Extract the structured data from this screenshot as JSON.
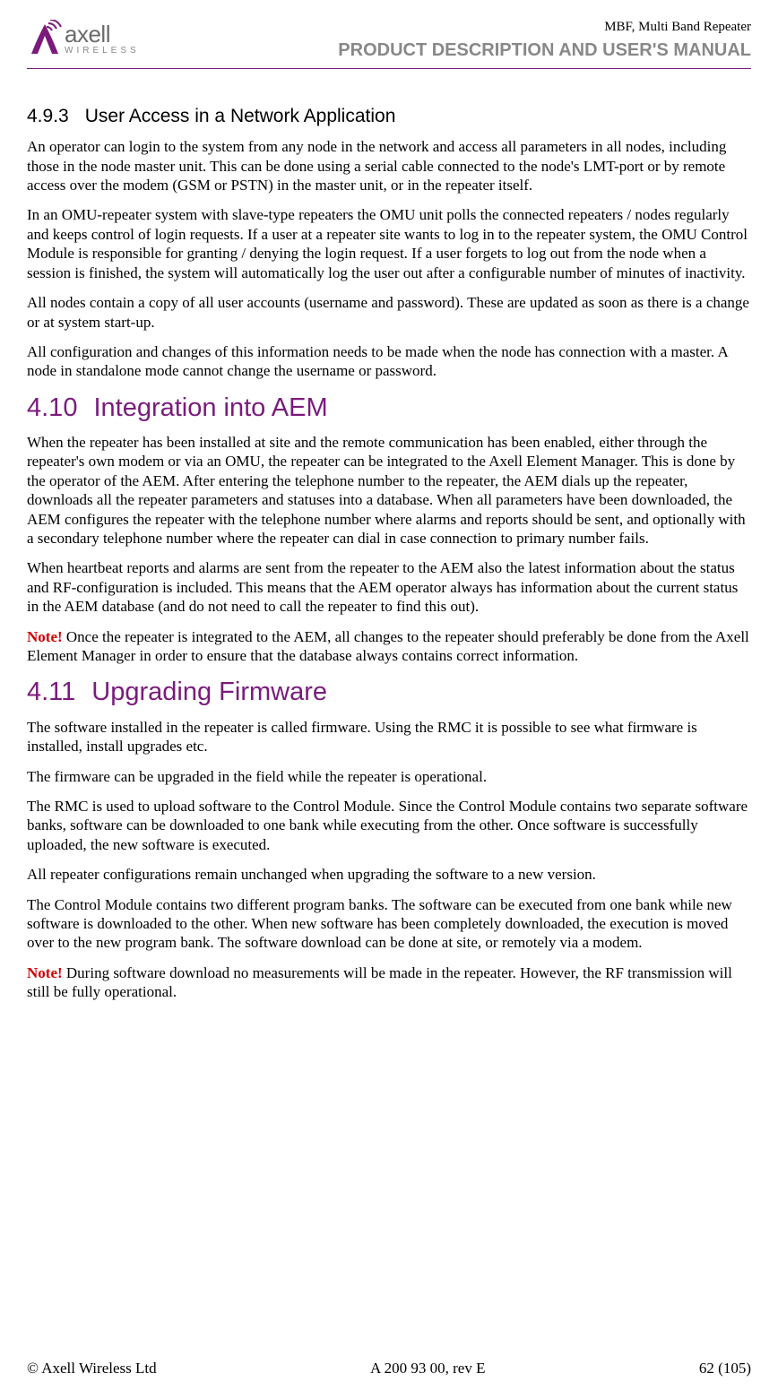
{
  "header": {
    "logo_brand": "axell",
    "logo_sub": "WIRELESS",
    "product_line": "MBF, Multi Band Repeater",
    "manual_title": "PRODUCT DESCRIPTION AND USER'S MANUAL"
  },
  "sections": {
    "s493": {
      "num": "4.9.3",
      "title": "User Access in a Network Application",
      "p1": "An operator can login to the system from any node in the network and access all parameters in all nodes, including those in the node master unit. This can be done using a serial cable connected to the node's LMT-port or by remote access over the modem (GSM or PSTN) in the master unit, or in the repeater itself.",
      "p2": "In an OMU-repeater system with slave-type repeaters the OMU unit polls the connected repeaters / nodes regularly and keeps control of login requests. If a user at a repeater site wants to log in to the repeater system, the OMU Control Module is responsible for granting / denying the login request. If a user forgets to log out from the node when a session is finished, the system will automatically log the user out after a configurable number of minutes of inactivity.",
      "p3": "All nodes contain a copy of all user accounts (username and password). These are updated as soon as there is a change or at system start-up.",
      "p4": "All configuration and changes of this information needs to be made when the node has connection with a master. A node in standalone mode cannot change the username or password."
    },
    "s410": {
      "num": "4.10",
      "title": "Integration into AEM",
      "p1": "When the repeater has been installed at site and the remote communication has been enabled, either through the repeater's own modem or via an OMU, the repeater can be integrated to the Axell Element Manager. This is done by the operator of the AEM. After entering the telephone number to the repeater, the AEM dials up the repeater, downloads all the repeater parameters and statuses into a database. When all parameters have been downloaded, the AEM configures the repeater with the telephone number where alarms and reports should be sent, and optionally with a secondary telephone number where the repeater can dial in case connection to primary number fails.",
      "p2": "When heartbeat reports and alarms are sent from the repeater to the AEM also the latest information about the status and RF-configuration is included. This means that the AEM operator always has information about the current status in the AEM database (and do not need to call the repeater to find this out).",
      "note_label": "Note!",
      "note_text": " Once the repeater is integrated to the AEM, all changes to the repeater should preferably be done from the Axell Element Manager in order to ensure that the database always contains correct information."
    },
    "s411": {
      "num": "4.11",
      "title": "Upgrading Firmware",
      "p1": "The software installed in the repeater is called firmware. Using the RMC it is possible to see what firmware is installed, install upgrades etc.",
      "p2": "The firmware can be upgraded in the field while the repeater is operational.",
      "p3": "The RMC is used to upload software to the Control Module. Since the Control Module contains two separate software banks, software can be downloaded to one bank while executing from the other. Once software is successfully uploaded, the new software is executed.",
      "p4": "All repeater configurations remain unchanged when upgrading the software to a new version.",
      "p5": "The Control Module contains two different program banks. The software can be executed from one bank while new software is downloaded to the other. When new software has been completely downloaded, the execution is moved over to the new program bank. The software download can be done at site, or remotely via a modem.",
      "note_label": "Note!",
      "note_text": " During software download no measurements will be made in the repeater. However, the RF transmission will still be fully operational."
    }
  },
  "footer": {
    "left": "© Axell Wireless Ltd",
    "center": "A 200 93 00, rev E",
    "right": "62 (105)"
  }
}
